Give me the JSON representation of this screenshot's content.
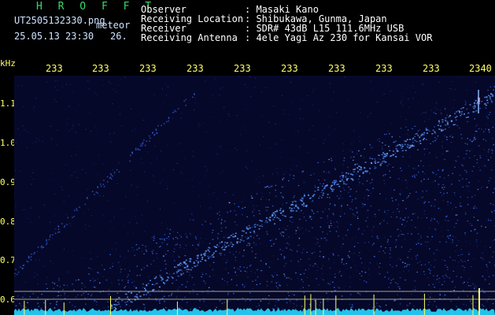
{
  "header": {
    "brand": "H R O F F T",
    "filename": "UT2505132330.png",
    "timestamp": "25.05.13 23:30",
    "counter": "26.",
    "type_label": "meteor",
    "fields": [
      {
        "label": "Observer",
        "value": ": Masaki Kano"
      },
      {
        "label": "Receiving Location",
        "value": ": Shibukawa, Gunma, Japan"
      },
      {
        "label": "Receiver",
        "value": ": SDR# 43dB L15 111.6MHz USB"
      },
      {
        "label": "Receiving Antenna",
        "value": ": 4ele Yagi Az 230 for Kansai VOR"
      }
    ]
  },
  "time_axis": {
    "ticks": [
      "233",
      "233",
      "233",
      "233",
      "233",
      "233",
      "233",
      "233",
      "233",
      "2340"
    ]
  },
  "freq_axis": {
    "unit": "kHz",
    "ticks": [
      "1.1",
      "1.0",
      "0.9",
      "0.8",
      "0.7",
      "0.6"
    ]
  },
  "colors": {
    "background": "#06082a",
    "text": "#ffffff",
    "brand": "#39d96a",
    "axis": "#ffff66",
    "signal": "#3a78ff",
    "noise_floor": "#26d7ff"
  }
}
